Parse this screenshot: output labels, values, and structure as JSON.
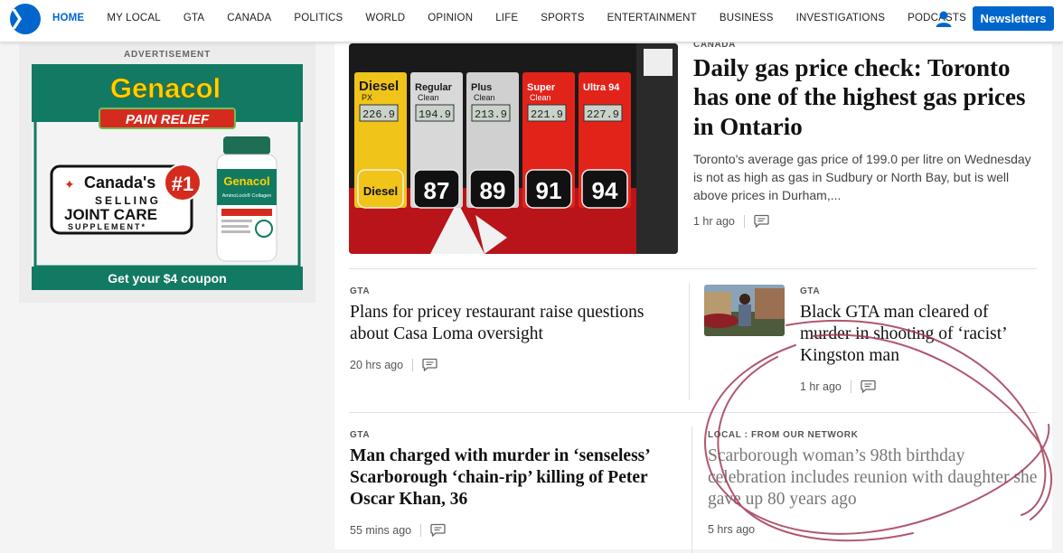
{
  "nav": {
    "items": [
      "HOME",
      "MY LOCAL",
      "GTA",
      "CANADA",
      "POLITICS",
      "WORLD",
      "OPINION",
      "LIFE",
      "SPORTS",
      "ENTERTAINMENT",
      "BUSINESS",
      "INVESTIGATIONS",
      "PODCASTS"
    ],
    "active": "HOME",
    "newsletters_label": "Newsletters",
    "user_icon": "user-icon",
    "accent_color": "#0066cc"
  },
  "ad": {
    "label": "ADVERTISEMENT",
    "brand": "Genacol",
    "tagline": "PAIN RELIEF",
    "badge_line1": "Canada's",
    "badge_line2": "SELLING",
    "badge_line3": "JOINT CARE",
    "badge_line4": "SUPPLEMENT*",
    "rank": "#1",
    "bottle_brand": "Genacol",
    "bottle_sub": "AminoLock® Collagen",
    "cta": "Get your $4 coupon"
  },
  "hero": {
    "kicker": "CANADA",
    "headline": "Daily gas price check: Toronto has one of the highest gas prices in Ontario",
    "summary": "Toronto's average gas price of 199.0 per litre on Wednesday is not as high as gas in Sudbury or North Bay, but is well above prices in Durham,...",
    "time": "1 hr ago",
    "photo": {
      "pump_labels": [
        "Diesel",
        "Regular",
        "Plus",
        "Super",
        "Ultra 94"
      ],
      "pump_sublabels": [
        "PX",
        "Clean",
        "Clean",
        "Clean",
        ""
      ],
      "prices": [
        "226.9",
        "194.9",
        "213.9",
        "221.9",
        "227.9"
      ],
      "octanes": [
        "Diesel",
        "87",
        "89",
        "91",
        "94"
      ]
    }
  },
  "articles": [
    {
      "kicker": "GTA",
      "headline": "Plans for pricey restaurant raise questions about Casa Loma oversight",
      "time": "20 hrs ago"
    },
    {
      "kicker": "GTA",
      "headline": "Black GTA man cleared of murder in shooting of ‘racist’ Kingston man",
      "time": "1 hr ago"
    },
    {
      "kicker": "GTA",
      "headline": "Man charged with murder in ‘senseless’ Scarborough ‘chain-rip’ killing of Peter Oscar Khan, 36",
      "time": "55 mins ago"
    },
    {
      "kicker": "LOCAL : FROM OUR NETWORK",
      "headline": "Scarborough woman’s 98th birthday celebration includes reunion with daughter she gave up 80 years ago",
      "time": "5 hrs ago"
    }
  ],
  "colors": {
    "scribble": "#a23a55",
    "ad_green": "#0f7a61",
    "ad_yellow": "#ffd200"
  }
}
